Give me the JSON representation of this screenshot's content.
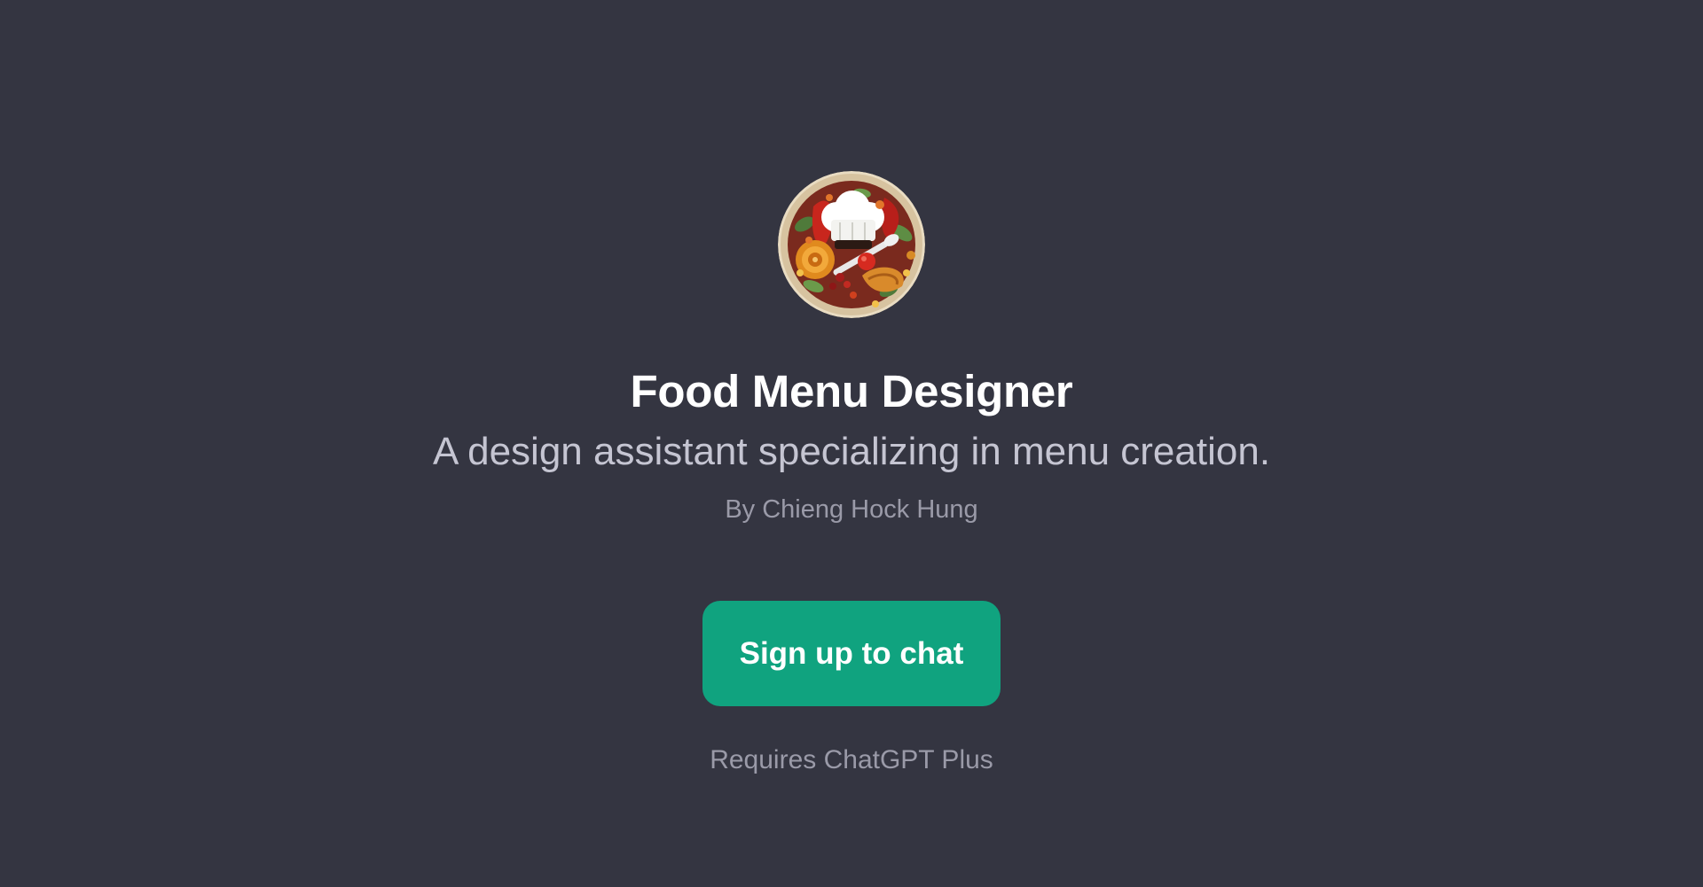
{
  "gpt": {
    "name": "Food Menu Designer",
    "description": "A design assistant specializing in menu creation.",
    "author": "By Chieng Hock Hung",
    "avatar_icon": "chef-hat-food-illustration-icon"
  },
  "actions": {
    "signup_label": "Sign up to chat",
    "requirement": "Requires ChatGPT Plus"
  },
  "colors": {
    "background": "#343541",
    "accent": "#10a37f",
    "title": "#ffffff",
    "subtitle": "#c5c5d2",
    "muted": "#9a9aa8"
  }
}
